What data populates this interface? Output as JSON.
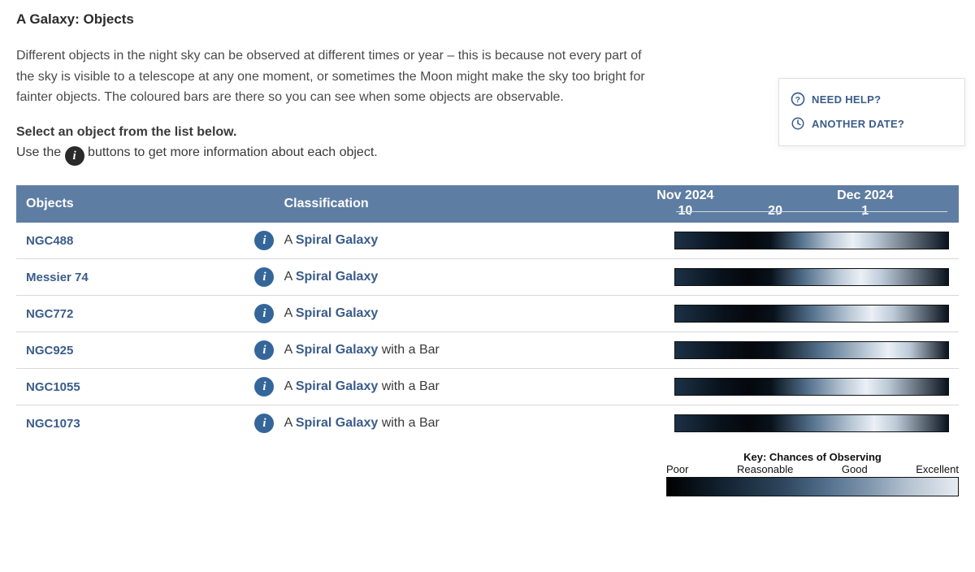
{
  "title": "A Galaxy: Objects",
  "intro": "Different objects in the night sky can be observed at different times or year – this is because not every part of the sky is visible to a telescope at any one moment, or sometimes the Moon might make the sky too bright for fainter objects. The coloured bars are there so you can see when some objects are observable.",
  "instruction_bold": "Select an object from the list below.",
  "instruction_rest_a": "Use the ",
  "instruction_rest_b": " buttons to get more information about each object.",
  "help": {
    "need_help": "NEED HELP?",
    "another_date": "ANOTHER DATE?"
  },
  "columns": {
    "objects": "Objects",
    "classification": "Classification"
  },
  "timeline": {
    "ticks": [
      {
        "pos": 5,
        "top": "Nov 2024",
        "bottom": "10"
      },
      {
        "pos": 37,
        "top": "",
        "bottom": "20"
      },
      {
        "pos": 69,
        "top": "Dec 2024",
        "bottom": "1"
      }
    ]
  },
  "class_prefix": "A ",
  "class_link_text": "Spiral Galaxy",
  "class_bar_suffix": " with a Bar",
  "rows": [
    {
      "name": "NGC488",
      "has_bar": false,
      "worst": 27,
      "best": 65
    },
    {
      "name": "Messier 74",
      "has_bar": false,
      "worst": 27,
      "best": 68
    },
    {
      "name": "NGC772",
      "has_bar": false,
      "worst": 28,
      "best": 72
    },
    {
      "name": "NGC925",
      "has_bar": true,
      "worst": 28,
      "best": 78
    },
    {
      "name": "NGC1055",
      "has_bar": true,
      "worst": 27,
      "best": 70
    },
    {
      "name": "NGC1073",
      "has_bar": true,
      "worst": 27,
      "best": 73
    }
  ],
  "legend": {
    "title": "Key: Chances of Observing",
    "labels": [
      "Poor",
      "Reasonable",
      "Good",
      "Excellent"
    ]
  },
  "colors": {
    "header_bg": "#5e7da3",
    "link": "#3a5c8a"
  }
}
